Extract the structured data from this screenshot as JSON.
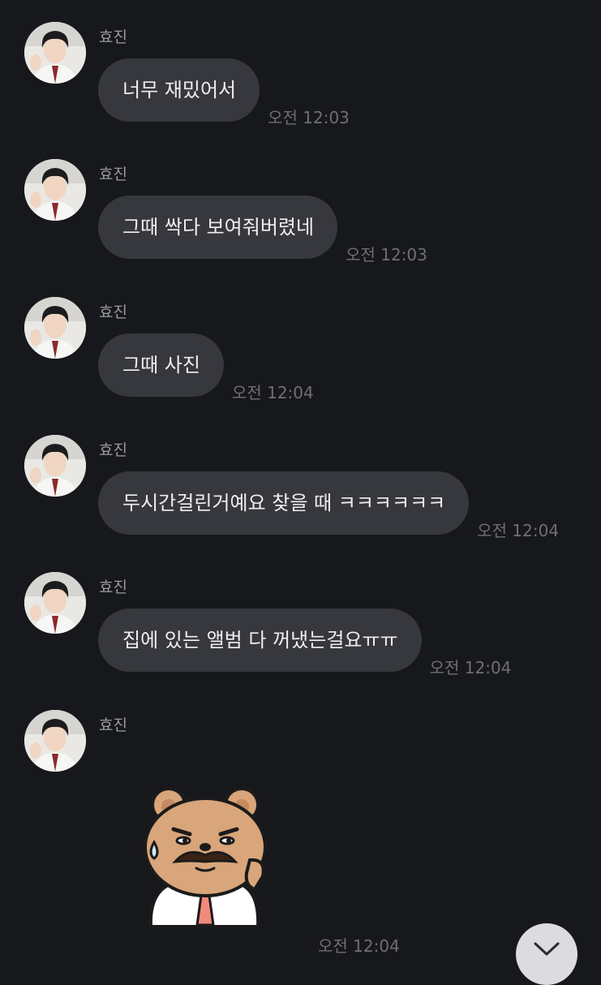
{
  "messages": [
    {
      "sender": "효진",
      "text": "너무 재밌어서",
      "time": "오전 12:03"
    },
    {
      "sender": "효진",
      "text": "그때 싹다 보여줘버렸네",
      "time": "오전 12:03"
    },
    {
      "sender": "효진",
      "text": "그때 사진",
      "time": "오전 12:04"
    },
    {
      "sender": "효진",
      "text": "두시간걸린거예요 찾을 때 ㅋㅋㅋㅋㅋㅋ",
      "time": "오전 12:04"
    },
    {
      "sender": "효진",
      "text": "집에 있는 앨범 다 꺼냈는걸요ㅠㅠ",
      "time": "오전 12:04"
    }
  ],
  "sticker_message": {
    "sender": "효진",
    "sticker": "bear-mustache-sweat-sticker",
    "time": "오전 12:04"
  },
  "icons": {
    "scroll_down": "chevron-down-icon"
  },
  "colors": {
    "background": "#17181c",
    "bubble": "#37383d",
    "text": "#eeeef0",
    "meta": "#6e6f74"
  }
}
